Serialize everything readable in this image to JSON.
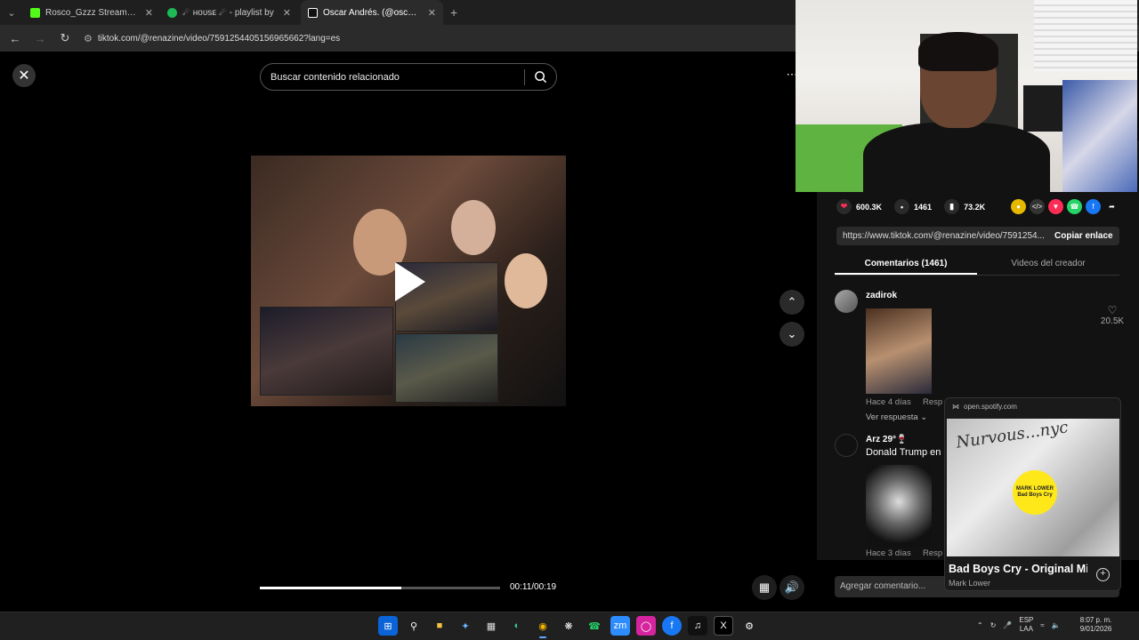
{
  "browser": {
    "tabs": [
      {
        "title": "Rosco_Gzzz Stream - Watch Liv",
        "favicon_color": "#53fc18",
        "active": false
      },
      {
        "title": "☄ ʜᴏᴜѕᴇ ☄ - playlist by",
        "favicon_color": "#1db954",
        "active": false
      },
      {
        "title": "Oscar Andrés. (@oscar_andres",
        "favicon_color": "#111111",
        "active": true
      }
    ],
    "new_tab": "+",
    "url": "tiktok.com/@renazine/video/7591254405156965662?lang=es"
  },
  "tiktok": {
    "search_placeholder": "Buscar contenido relacionado",
    "timecode": "00:11/00:19",
    "progress_fraction": 0.59,
    "stats": {
      "likes": "600.3K",
      "comments": "1461",
      "saves": "73.2K"
    },
    "share_url": "https://www.tiktok.com/@renazine/video/7591254...",
    "copy_label": "Copiar enlace",
    "tabs": [
      "Comentarios (1461)",
      "Videos del creador"
    ],
    "comments": [
      {
        "user": "zadirok",
        "text": "",
        "time": "Hace 4 días",
        "reply": "Resp",
        "likes": "20.5K",
        "see_replies": "Ver respuesta"
      },
      {
        "user": "Arz 29°🍷",
        "text": "Donald Trump en",
        "time": "Hace 3 días",
        "reply": "Resp"
      }
    ],
    "comment_placeholder": "Agregar comentario..."
  },
  "spotify_mini": {
    "source": "open.spotify.com",
    "art_text": "Nurvous...nyc",
    "sticker_line1": "MARK LOWER",
    "sticker_line2": "Bad Boys Cry",
    "song": "Bad Boys Cry - Original Mi",
    "artist": "Mark Lower"
  },
  "taskbar": {
    "lang1": "ESP",
    "lang2": "LAA",
    "time": "8:07 p. m.",
    "date": "9/01/2026"
  }
}
